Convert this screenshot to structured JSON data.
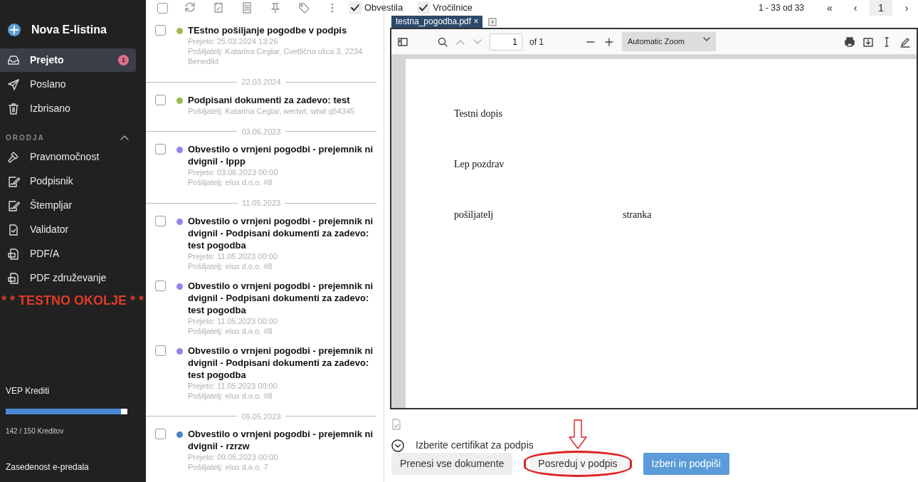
{
  "sidebar": {
    "new_button": "Nova E-listina",
    "nav": [
      {
        "label": "Prejeto",
        "selected": true,
        "badge": "1"
      },
      {
        "label": "Poslano",
        "selected": false
      },
      {
        "label": "Izbrisano",
        "selected": false
      }
    ],
    "section": {
      "label": "ORODJA",
      "expanded": true
    },
    "tools": [
      {
        "label": "Pravnomočnost"
      },
      {
        "label": "Podpisnik"
      },
      {
        "label": "Štempljar"
      },
      {
        "label": "Validator"
      },
      {
        "label": "PDF/A"
      },
      {
        "label": "PDF združevanje"
      }
    ],
    "warning": "* * TESTNO OKOLJE * *",
    "credits": {
      "label": "VEP Krediti",
      "level": 0.947,
      "reading": "142 / 150 Kreditov"
    },
    "mailbox_label": "Zasedenost e-predala"
  },
  "toolbar": {
    "select_all_checked": false,
    "filters": [
      {
        "label": "Obvestila",
        "checked": true
      },
      {
        "label": "Vročilnice",
        "checked": true
      }
    ],
    "range": "1 - 33 od 33",
    "pager": [
      {
        "label": "«",
        "selected": false
      },
      {
        "label": "‹",
        "selected": false
      },
      {
        "label": "1",
        "selected": true
      },
      {
        "label": "›",
        "selected": false
      }
    ]
  },
  "messages": [
    {
      "kind": "message",
      "checked": false,
      "color": "#9cba4f",
      "title": "TEstno pošiljanje pogodbe v podpis",
      "meta": [
        "Prejeto: 25.03.2024 13:26",
        "Pošiljatelj: Katarina Ceglar, Cvetlična ulica 3, 2234 Benedikt"
      ]
    },
    {
      "kind": "separator",
      "date": "22.03.2024"
    },
    {
      "kind": "message",
      "checked": false,
      "color": "#9cba4f",
      "title": "Podpisani dokumenti za zadevo: test",
      "meta": [
        "Pošiljatelj: Katarina Ceglar, wertwt, wtwt q54345"
      ]
    },
    {
      "kind": "separator",
      "date": "03.06.2023"
    },
    {
      "kind": "message",
      "checked": false,
      "color": "#8f85ee",
      "title": "Obvestilo o vrnjeni pogodbi - prejemnik ni dvignil - lppp",
      "meta": [
        "Prejeto: 03.06.2023 00:00",
        "Pošiljatelj: elus d.o.o. #8"
      ]
    },
    {
      "kind": "separator",
      "date": "11.05.2023"
    },
    {
      "kind": "message",
      "checked": false,
      "color": "#8f85ee",
      "title": "Obvestilo o vrnjeni pogodbi - prejemnik ni dvignil - Podpisani dokumenti za zadevo: test pogodba",
      "meta": [
        "Prejeto: 11.05.2023 00:00",
        "Pošiljatelj: elus d.o.o. #8"
      ]
    },
    {
      "kind": "message",
      "checked": false,
      "color": "#8f85ee",
      "title": "Obvestilo o vrnjeni pogodbi - prejemnik ni dvignil - Podpisani dokumenti za zadevo: test pogodba",
      "meta": [
        "Prejeto: 11.05.2023 00:00",
        "Pošiljatelj: elus d.o.o. #8"
      ]
    },
    {
      "kind": "message",
      "checked": false,
      "color": "#8f85ee",
      "title": "Obvestilo o vrnjeni pogodbi - prejemnik ni dvignil - Podpisani dokumenti za zadevo: test pogodba",
      "meta": [
        "Prejeto: 11.05.2023 00:00",
        "Pošiljatelj: elus d.o.o. #8"
      ]
    },
    {
      "kind": "separator",
      "date": "09.05.2023"
    },
    {
      "kind": "message",
      "checked": false,
      "color": "#4a86c8",
      "title": "Obvestilo o vrnjeni pogodbi - prejemnik ni dvignil - rzrzw",
      "meta": [
        "Prejeto: 09.05.2023 00:00",
        "Pošiljatelj: elus d.o.o. 7"
      ]
    }
  ],
  "viewer": {
    "tab": "testna_pogodba.pdf",
    "close": "×",
    "page": "1",
    "of": "of 1",
    "zoom": "Automatic Zoom",
    "lines": [
      {
        "texts": [
          "Testni dopis"
        ]
      },
      {
        "texts": [
          "Lep pozdrav"
        ]
      },
      {
        "texts": [
          "pošiljatelj",
          "stranka"
        ]
      }
    ]
  },
  "certificate": {
    "label": "Izberite certifikat za podpis",
    "expanded": false
  },
  "buttons": [
    {
      "label": "Prenesi vse dokumente",
      "kind": "secondary",
      "annotated": false
    },
    {
      "label": "Posreduj v podpis",
      "kind": "light",
      "annotated": true
    },
    {
      "label": "Izberi in podpiši",
      "kind": "primary",
      "annotated": false
    }
  ]
}
